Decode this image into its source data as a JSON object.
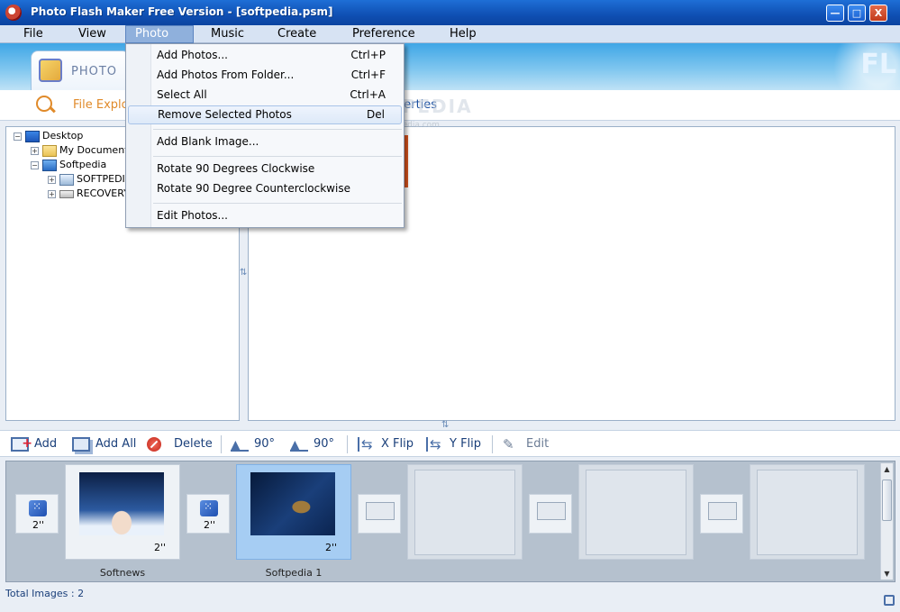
{
  "window": {
    "title": "Photo Flash Maker Free Version - [softpedia.psm]",
    "min_label": "—",
    "max_label": "□",
    "close_label": "X"
  },
  "menubar": {
    "items": [
      "File",
      "View",
      "Photo",
      "Music",
      "Create",
      "Preference",
      "Help"
    ],
    "active": "Photo"
  },
  "ribbon": {
    "tab_label": "PHOTO",
    "logo_text": "FL"
  },
  "subtabs": {
    "file_explorer": "File Explo",
    "properties": "perties"
  },
  "watermark": {
    "main": "SOFTPEDIA",
    "sub": "www.softpedia.com"
  },
  "tree": {
    "items": [
      "Desktop",
      "My Documents",
      "Softpedia",
      "SOFTPEDI",
      "RECOVERY"
    ]
  },
  "photo_menu": {
    "items": [
      {
        "label": "Add Photos...",
        "shortcut": "Ctrl+P"
      },
      {
        "label": "Add Photos From Folder...",
        "shortcut": "Ctrl+F"
      },
      {
        "label": "Select All",
        "shortcut": "Ctrl+A"
      },
      {
        "label": "Remove Selected Photos",
        "shortcut": "Del"
      },
      {
        "label": "Add Blank Image...",
        "shortcut": ""
      },
      {
        "label": "Rotate 90 Degrees Clockwise",
        "shortcut": ""
      },
      {
        "label": "Rotate 90 Degree Counterclockwise",
        "shortcut": ""
      },
      {
        "label": "Edit Photos...",
        "shortcut": ""
      }
    ],
    "highlighted": "Remove Selected Photos"
  },
  "toolbar": {
    "add": "Add",
    "add_all": "Add All",
    "delete": "Delete",
    "rotate_ccw": "90°",
    "rotate_cw": "90°",
    "x_flip": "X Flip",
    "y_flip": "Y Flip",
    "edit": "Edit"
  },
  "storyboard": {
    "transition_duration": "2''",
    "frames": [
      {
        "label": "Softnews",
        "duration": "2''"
      },
      {
        "label": "Softpedia 1",
        "duration": "2''"
      }
    ]
  },
  "status": {
    "total_images": "Total Images : 2"
  },
  "colors": {
    "titlebar": "#1e6fd6",
    "accent_orange": "#e08a2a",
    "selected_frame": "#a6cdf3"
  }
}
